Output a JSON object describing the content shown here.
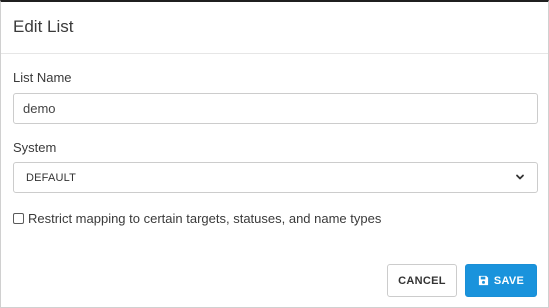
{
  "dialog": {
    "title": "Edit List"
  },
  "form": {
    "list_name": {
      "label": "List Name",
      "value": "demo"
    },
    "system": {
      "label": "System",
      "selected": "DEFAULT"
    },
    "restrict_mapping": {
      "label": "Restrict mapping to certain targets, statuses, and name types",
      "checked": false
    }
  },
  "footer": {
    "cancel_label": "CANCEL",
    "save_label": "SAVE"
  },
  "colors": {
    "primary": "#1a93dc",
    "border": "#cccccc",
    "text": "#333333"
  },
  "icons": {
    "select": "chevron-down-icon",
    "save": "floppy-disk-icon"
  }
}
